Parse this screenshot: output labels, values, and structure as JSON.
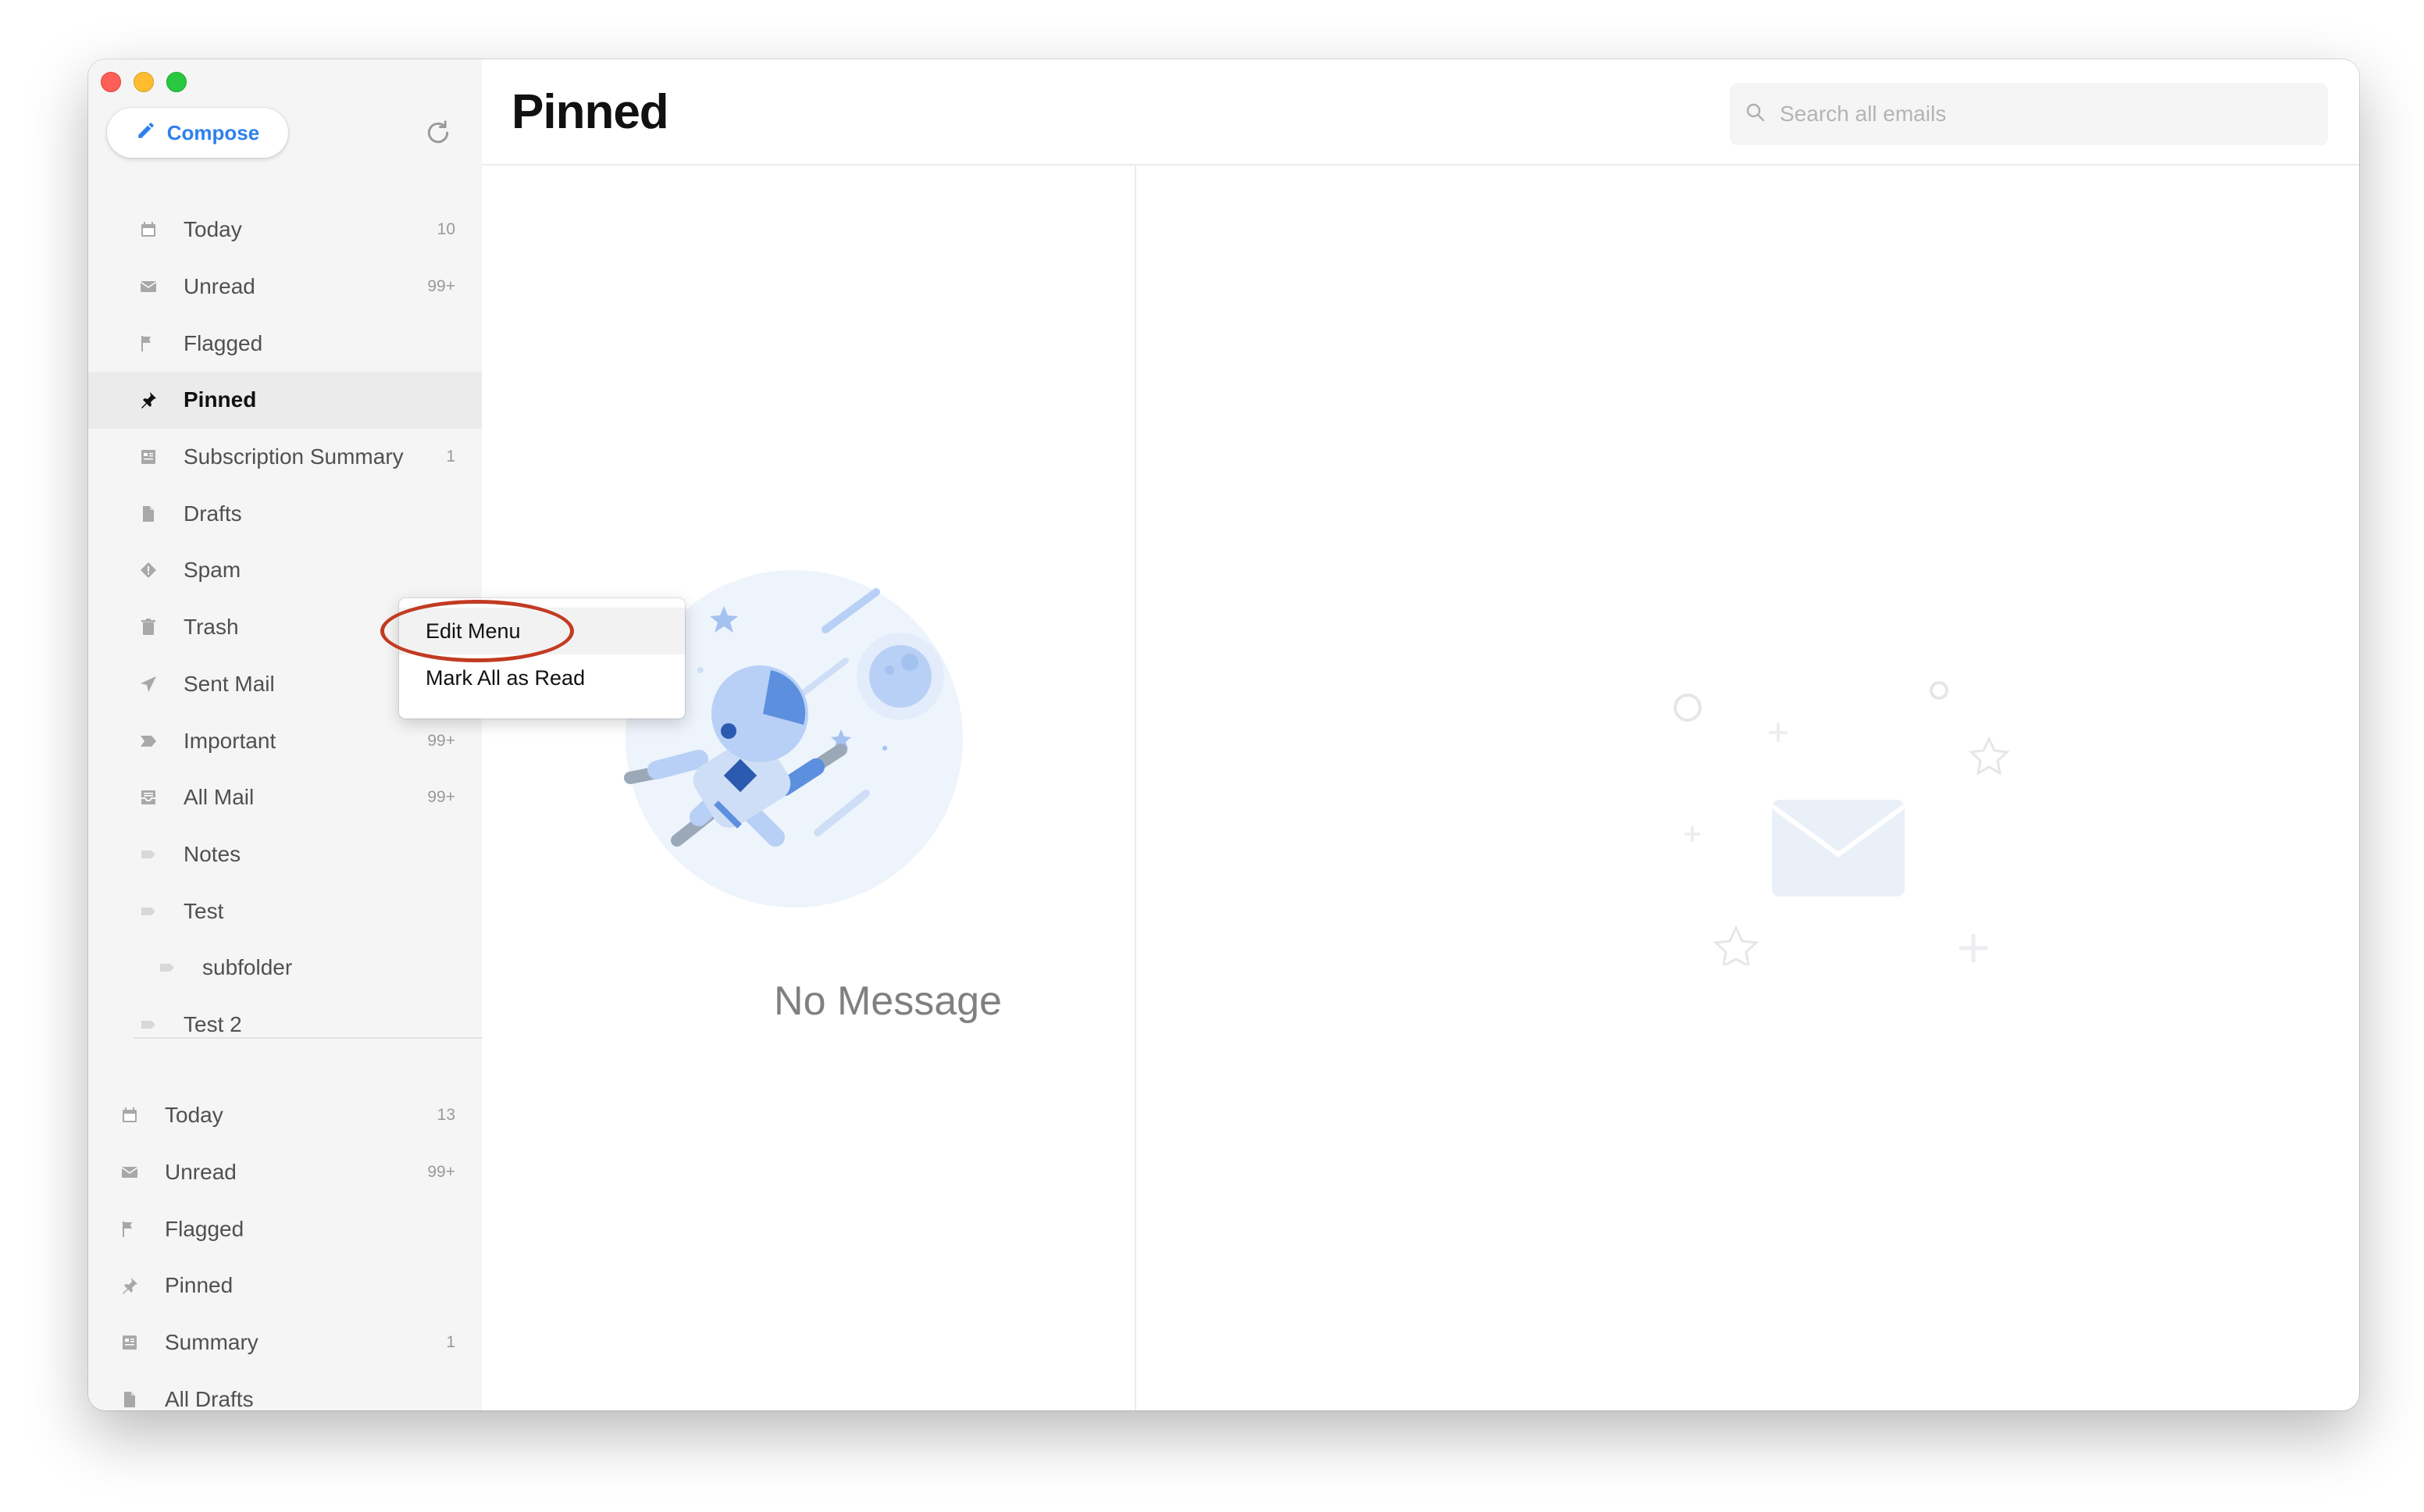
{
  "window": {
    "traffic_lights": [
      "close",
      "minimize",
      "maximize"
    ]
  },
  "sidebar": {
    "compose_label": "Compose",
    "items": [
      {
        "label": "Today",
        "count": "10",
        "icon": "calendar-icon"
      },
      {
        "label": "Unread",
        "count": "99+",
        "icon": "envelope-icon"
      },
      {
        "label": "Flagged",
        "count": "",
        "icon": "flag-icon"
      },
      {
        "label": "Pinned",
        "count": "",
        "icon": "pin-icon",
        "active": true
      },
      {
        "label": "Subscription Summary",
        "count": "1",
        "icon": "summary-icon"
      },
      {
        "label": "Drafts",
        "count": "",
        "icon": "document-icon"
      },
      {
        "label": "Spam",
        "count": "",
        "icon": "spam-icon"
      },
      {
        "label": "Trash",
        "count": "",
        "icon": "trash-icon"
      },
      {
        "label": "Sent Mail",
        "count": "",
        "icon": "send-icon"
      },
      {
        "label": "Important",
        "count": "99+",
        "icon": "important-icon"
      },
      {
        "label": "All Mail",
        "count": "99+",
        "icon": "inbox-icon"
      },
      {
        "label": "Notes",
        "count": "",
        "icon": "label-icon"
      },
      {
        "label": "Test",
        "count": "",
        "icon": "label-icon"
      },
      {
        "label": "subfolder",
        "count": "",
        "icon": "label-icon"
      },
      {
        "label": "Test 2",
        "count": "",
        "icon": "label-icon"
      }
    ],
    "items2": [
      {
        "label": "Today",
        "count": "13",
        "icon": "calendar-icon"
      },
      {
        "label": "Unread",
        "count": "99+",
        "icon": "envelope-icon"
      },
      {
        "label": "Flagged",
        "count": "",
        "icon": "flag-icon"
      },
      {
        "label": "Pinned",
        "count": "",
        "icon": "pin-icon"
      },
      {
        "label": "Summary",
        "count": "1",
        "icon": "summary-icon"
      },
      {
        "label": "All Drafts",
        "count": "",
        "icon": "document-icon"
      }
    ]
  },
  "main": {
    "title": "Pinned",
    "search_placeholder": "Search all emails",
    "empty_text": "No Message"
  },
  "context_menu": {
    "items": [
      "Edit Menu",
      "Mark All as Read"
    ]
  },
  "colors": {
    "accent": "#2f80ed",
    "annotation": "#c23b22"
  }
}
